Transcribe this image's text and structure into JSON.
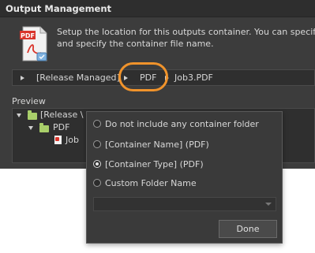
{
  "dialog": {
    "title": "Output Management",
    "description_line1": "Setup the location for this outputs container. You can specify a",
    "description_line2": "and specify the container file name.",
    "pdf_icon_text": "PDF"
  },
  "path": {
    "segments": [
      "[Release Managed]",
      "PDF",
      "Job3.PDF"
    ]
  },
  "preview": {
    "label": "Preview",
    "tree": [
      {
        "label": "[Release \\",
        "icon": "folder-icon"
      },
      {
        "label": "PDF",
        "icon": "folder-icon"
      },
      {
        "label": "Job",
        "icon": "pdf-file-icon"
      }
    ]
  },
  "popup": {
    "options": [
      {
        "label": "Do not include any container folder",
        "checked": false
      },
      {
        "label": "[Container Name] (PDF)",
        "checked": false
      },
      {
        "label": "[Container Type] (PDF)",
        "checked": true
      },
      {
        "label": "Custom Folder Name",
        "checked": false
      }
    ],
    "custom_folder_value": "",
    "done_label": "Done"
  },
  "colors": {
    "highlight": "#f0932b",
    "folder": "#a9cf6a",
    "pdf_red": "#d9342b"
  }
}
